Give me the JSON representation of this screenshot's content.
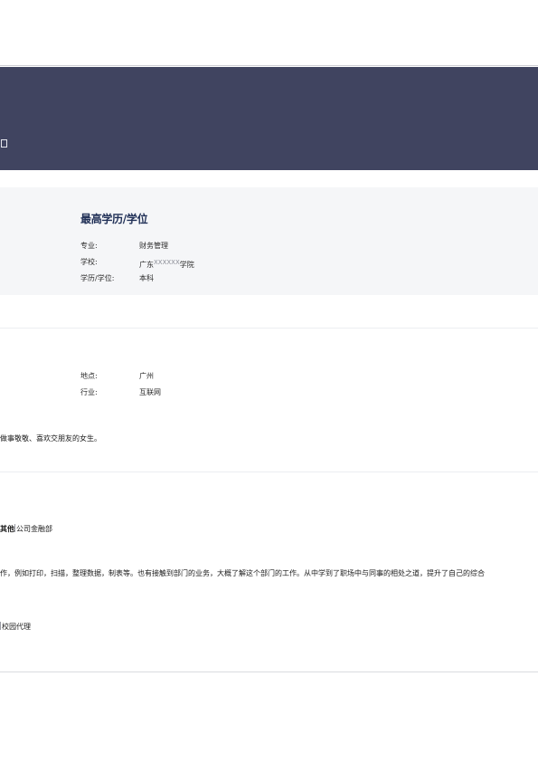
{
  "education": {
    "title": "最高学历/学位",
    "rows": [
      {
        "label": "专业:",
        "value": "财务管理"
      },
      {
        "label": "学校:",
        "value_prefix": "广东",
        "value_sup": "XXXXXX",
        "value_suffix": "学院"
      },
      {
        "label": "学历/学位:",
        "value": "本科"
      }
    ]
  },
  "intention": {
    "rows": [
      {
        "label": "地点:",
        "value": "广州"
      },
      {
        "label": "行业:",
        "value": "互联网"
      }
    ]
  },
  "self_evaluation": {
    "text": "做事敬敬、喜欢交朋友的女生。"
  },
  "experience": {
    "entry1_title": "其他",
    "entry1_company": "公司金融部",
    "entry1_desc": "作，例如打印，扫描，整理数据，制表等。也有接触到部门的业务，大概了解这个部门的工作。从中学到了职场中与同事的相处之道，提升了自己的综合",
    "entry2_company": "校园代理"
  }
}
